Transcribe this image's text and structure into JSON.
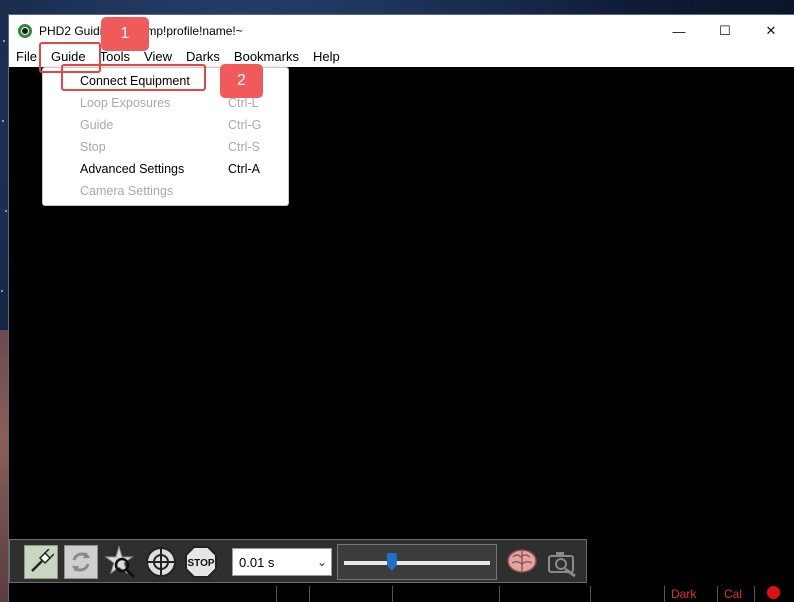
{
  "window": {
    "title": "PHD2 Guiding - ..!temp!profile!name!~",
    "controls": {
      "minimize": "—",
      "maximize": "☐",
      "close": "✕"
    }
  },
  "menubar": {
    "items": [
      "File",
      "Guide",
      "Tools",
      "View",
      "Darks",
      "Bookmarks",
      "Help"
    ]
  },
  "guide_menu": {
    "items": [
      {
        "label": "Connect Equipment",
        "accel": "",
        "enabled": true
      },
      {
        "label": "Loop Exposures",
        "accel": "Ctrl-L",
        "enabled": false
      },
      {
        "label": "Guide",
        "accel": "Ctrl-G",
        "enabled": false
      },
      {
        "label": "Stop",
        "accel": "Ctrl-S",
        "enabled": false
      },
      {
        "label": "Advanced Settings",
        "accel": "Ctrl-A",
        "enabled": true
      },
      {
        "label": "Camera Settings",
        "accel": "",
        "enabled": false
      }
    ]
  },
  "annotations": [
    {
      "number": "1",
      "target": "Guide"
    },
    {
      "number": "2",
      "target": "Connect Equipment"
    }
  ],
  "toolbar": {
    "buttons": [
      "connect-equipment",
      "loop",
      "auto-select-star",
      "guide",
      "stop"
    ],
    "exposure": {
      "value": "0.01 s"
    },
    "gamma_level": 0.31,
    "right_buttons": [
      "brain",
      "camera-settings"
    ]
  },
  "statusbar": {
    "dark_label": "Dark",
    "cal_label": "Cal",
    "indicator_color": "#e01010"
  },
  "colors": {
    "annotation": "#e64545",
    "status_text": "#e03131"
  }
}
